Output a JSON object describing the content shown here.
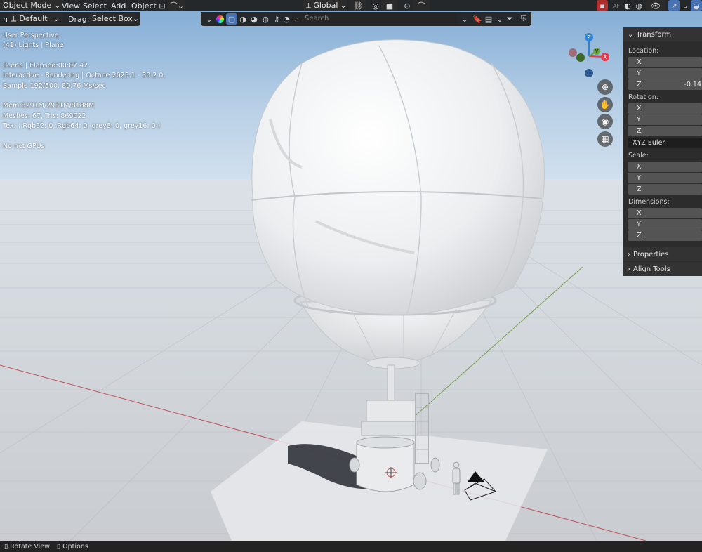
{
  "header": {
    "mode": "Object Mode",
    "menus": [
      "View",
      "Select",
      "Add",
      "Object"
    ],
    "transform_orientation": "Global"
  },
  "toolrow": {
    "orientation_prefix": "n:",
    "orientation_value": "Default",
    "drag_label": "Drag:",
    "drag_value": "Select Box"
  },
  "shading": {
    "search_placeholder": "Search"
  },
  "overlay": {
    "lines": [
      "User Perspective",
      "(41) Lights | Plane",
      "Scene | Elapsed:00:07.42",
      "Interactive - Rendering | Octane 2025.1 - 30.2.0.",
      "Sample 192/500, 80.76 Ms/sec",
      "Mem:3291M/2931M/8188M",
      "Meshes: 67, Tris: 869022",
      "Tex: ( Rgb32: 0, Rgb64: 0, grey8: 0, grey16: 0 )",
      "No net GPUs"
    ]
  },
  "gizmo": {
    "z_label": "Z",
    "y_label": "Y",
    "x_label": "X",
    "colors": {
      "x": "#e8374b",
      "y": "#6aa33e",
      "z": "#2f83d6"
    }
  },
  "npanel": {
    "transform_title": "Transform",
    "location_label": "Location:",
    "location": [
      {
        "axis": "X",
        "value": ""
      },
      {
        "axis": "Y",
        "value": ""
      },
      {
        "axis": "Z",
        "value": "-0.14"
      }
    ],
    "rotation_label": "Rotation:",
    "rotation": [
      {
        "axis": "X",
        "value": ""
      },
      {
        "axis": "Y",
        "value": ""
      },
      {
        "axis": "Z",
        "value": ""
      }
    ],
    "rotation_mode": "XYZ Euler",
    "scale_label": "Scale:",
    "scale": [
      {
        "axis": "X",
        "value": ""
      },
      {
        "axis": "Y",
        "value": ""
      },
      {
        "axis": "Z",
        "value": ""
      }
    ],
    "dimensions_label": "Dimensions:",
    "dimensions": [
      {
        "axis": "X",
        "value": ""
      },
      {
        "axis": "Y",
        "value": ""
      },
      {
        "axis": "Z",
        "value": ""
      }
    ],
    "properties_title": "Properties",
    "align_tools_title": "Align Tools"
  },
  "statusbar": {
    "rotate_view": "Rotate View",
    "options": "Options"
  },
  "colors": {
    "accent": "#4772b3",
    "sky_top": "#8ab0d6",
    "ground": "#d5d8dc"
  }
}
